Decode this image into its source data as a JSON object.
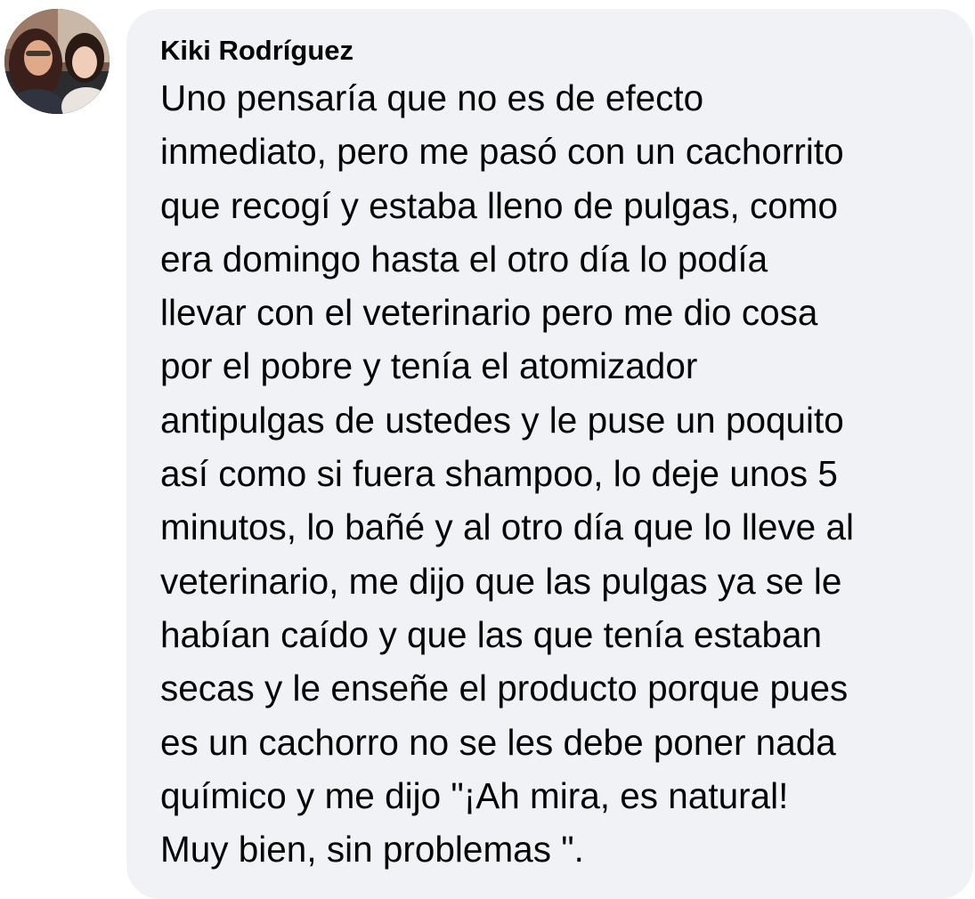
{
  "comment": {
    "author": "Kiki Rodríguez",
    "avatar_icon": "profile-photo",
    "lines": [
      "Uno pensaría que no es de efecto",
      "inmediato, pero me pasó con un cachorrito",
      "que recogí y estaba lleno de pulgas, como",
      "era domingo hasta el otro día lo podía",
      "llevar con el veterinario pero me dio cosa",
      "por el pobre y tenía el atomizador",
      "antipulgas de ustedes y le puse un poquito",
      "así como si fuera shampoo, lo deje unos 5",
      "minutos, lo bañé y al otro día que lo lleve al",
      "veterinario, me dijo que las pulgas ya se le",
      "habían caído y que las que tenía estaban",
      "secas y le enseñe el producto porque pues",
      "es un cachorro no se les debe poner nada",
      "químico y me dijo \"¡Ah mira, es natural!",
      "Muy bien, sin problemas \"."
    ]
  },
  "colors": {
    "bubble_background": "#f0f2f5",
    "text": "#050505"
  }
}
